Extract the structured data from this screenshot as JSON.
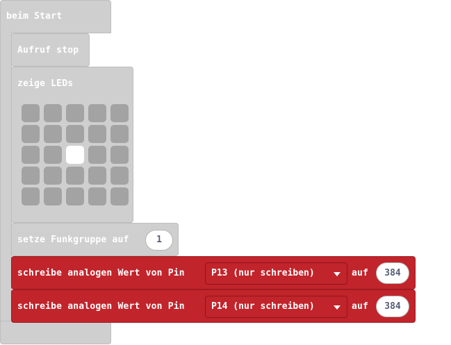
{
  "blocks": {
    "on_start": {
      "label": "beim Start"
    },
    "call_stop": {
      "label": "Aufruf stop"
    },
    "show_leds": {
      "label": "zeige LEDs",
      "grid": [
        [
          0,
          0,
          0,
          0,
          0
        ],
        [
          0,
          0,
          0,
          0,
          0
        ],
        [
          0,
          0,
          1,
          0,
          0
        ],
        [
          0,
          0,
          0,
          0,
          0
        ],
        [
          0,
          0,
          0,
          0,
          0
        ]
      ]
    },
    "set_group": {
      "label": "setze Funkgruppe auf",
      "value": "1"
    },
    "analog_writes": [
      {
        "label": "schreibe analogen Wert von Pin",
        "pin": "P13 (nur schreiben)",
        "conj": "auf",
        "value": "384"
      },
      {
        "label": "schreibe analogen Wert von Pin",
        "pin": "P14 (nur schreiben)",
        "conj": "auf",
        "value": "384"
      }
    ]
  },
  "colors": {
    "control_gray": "#cfcfcf",
    "led_off": "#a3a3a3",
    "led_on": "#ffffff",
    "pins_red": "#c1242b"
  }
}
